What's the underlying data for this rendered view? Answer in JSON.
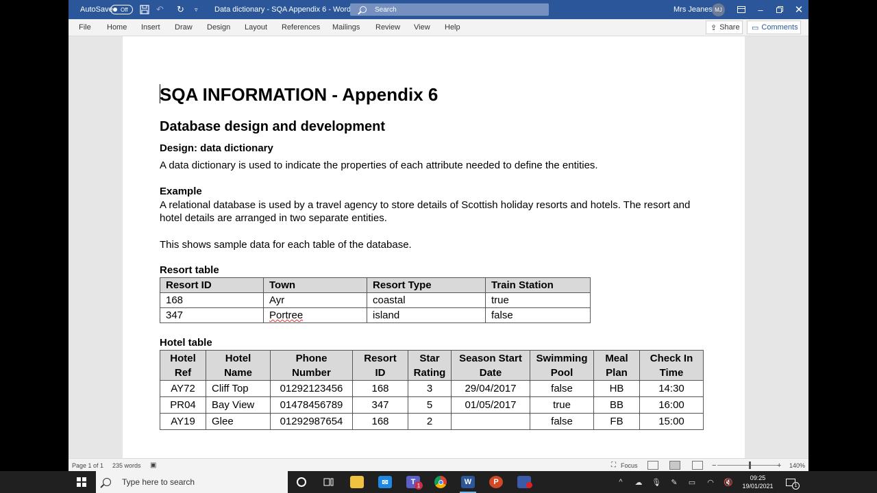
{
  "titlebar": {
    "autosave_label": "AutoSave",
    "autosave_state": "Off",
    "doc_title": "Data dictionary - SQA Appendix 6  -  Word",
    "search_placeholder": "Search",
    "user_name": "Mrs Jeanes",
    "user_initials": "MJ"
  },
  "ribbon": {
    "tabs": [
      "File",
      "Home",
      "Insert",
      "Draw",
      "Design",
      "Layout",
      "References",
      "Mailings",
      "Review",
      "View",
      "Help"
    ],
    "share_label": "Share",
    "comments_label": "Comments"
  },
  "document": {
    "title": "SQA INFORMATION - Appendix 6",
    "heading2": "Database design and development",
    "heading3": "Design: data dictionary",
    "intro": "A data dictionary is used to indicate the properties of each attribute needed to define the entities.",
    "example_heading": "Example",
    "example_text_1": "A relational database is used by a travel agency to store details of Scottish holiday resorts and hotels. The resort and hotel details are arranged in two separate entities.",
    "sample_text": "This shows sample data for each table of the database.",
    "resort_table": {
      "title": "Resort table",
      "headers": [
        "Resort ID",
        "Town",
        "Resort Type",
        "Train Station"
      ],
      "rows": [
        [
          "168",
          "Ayr",
          "coastal",
          "true"
        ],
        [
          "347",
          "Portree",
          "island",
          "false"
        ]
      ]
    },
    "hotel_table": {
      "title": "Hotel table",
      "headers": [
        [
          "Hotel",
          "Ref"
        ],
        [
          "Hotel",
          "Name"
        ],
        [
          "Phone",
          "Number"
        ],
        [
          "Resort",
          "ID"
        ],
        [
          "Star",
          "Rating"
        ],
        [
          "Season Start",
          "Date"
        ],
        [
          "Swimming",
          "Pool"
        ],
        [
          "Meal",
          "Plan"
        ],
        [
          "Check In",
          "Time"
        ]
      ],
      "rows": [
        [
          "AY72",
          "Cliff Top",
          "01292123456",
          "168",
          "3",
          "29/04/2017",
          "false",
          "HB",
          "14:30"
        ],
        [
          "PR04",
          "Bay View",
          "01478456789",
          "347",
          "5",
          "01/05/2017",
          "true",
          "BB",
          "16:00"
        ],
        [
          "AY19",
          "Glee",
          "01292987654",
          "168",
          "2",
          "",
          "false",
          "FB",
          "15:00"
        ]
      ]
    }
  },
  "statusbar": {
    "page": "Page 1 of 1",
    "words": "235 words",
    "focus": "Focus",
    "zoom": "140%",
    "zoom_minus": "−",
    "zoom_plus": "+"
  },
  "taskbar": {
    "search_placeholder": "Type here to search",
    "teams_badge": "1",
    "time": "09:25",
    "date": "19/01/2021",
    "notification_count": "1"
  },
  "colors": {
    "word_blue": "#2b579a",
    "table_header": "#d9d9d9",
    "taskbar": "#202020"
  }
}
